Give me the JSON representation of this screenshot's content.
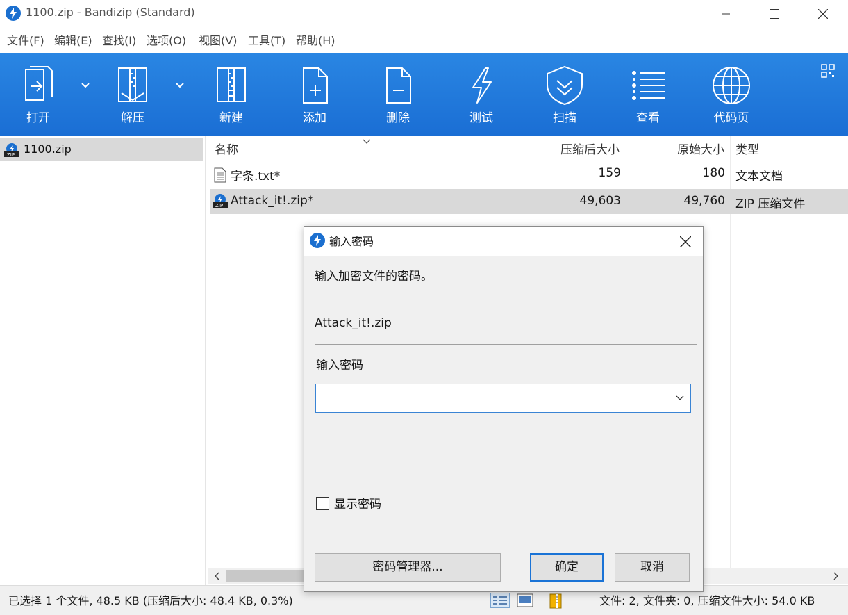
{
  "window": {
    "title": "1100.zip - Bandizip (Standard)"
  },
  "menu": [
    "文件(F)",
    "编辑(E)",
    "查找(I)",
    "选项(O)",
    "视图(V)",
    "工具(T)",
    "帮助(H)"
  ],
  "toolbar": {
    "open": "打开",
    "extract": "解压",
    "new": "新建",
    "add": "添加",
    "delete": "删除",
    "test": "测试",
    "scan": "扫描",
    "view": "查看",
    "codepage": "代码页"
  },
  "tree": {
    "root": "1100.zip"
  },
  "filelist": {
    "columns": {
      "name": "名称",
      "compressed": "压缩后大小",
      "original": "原始大小",
      "type": "类型"
    },
    "rows": [
      {
        "name": "字条.txt*",
        "compressed": "159",
        "original": "180",
        "type": "文本文档",
        "icon": "text-file-icon",
        "selected": false
      },
      {
        "name": "Attack_it!.zip*",
        "compressed": "49,603",
        "original": "49,760",
        "type": "ZIP 压缩文件",
        "icon": "zip-file-icon",
        "selected": true
      }
    ]
  },
  "status": {
    "left": "已选择 1 个文件, 48.5 KB (压缩后大小: 48.4 KB, 0.3%)",
    "right": "文件: 2, 文件夹: 0, 压缩文件大小: 54.0 KB"
  },
  "dialog": {
    "title": "输入密码",
    "prompt": "输入加密文件的密码。",
    "filename": "Attack_it!.zip",
    "field_label": "输入密码",
    "password_value": "",
    "show_password_label": "显示密码",
    "show_password_checked": false,
    "manager_button": "密码管理器...",
    "ok_button": "确定",
    "cancel_button": "取消"
  },
  "colors": {
    "toolbar": "#1f78dc",
    "accent": "#1a73d6",
    "selection": "#d9d9d9"
  }
}
